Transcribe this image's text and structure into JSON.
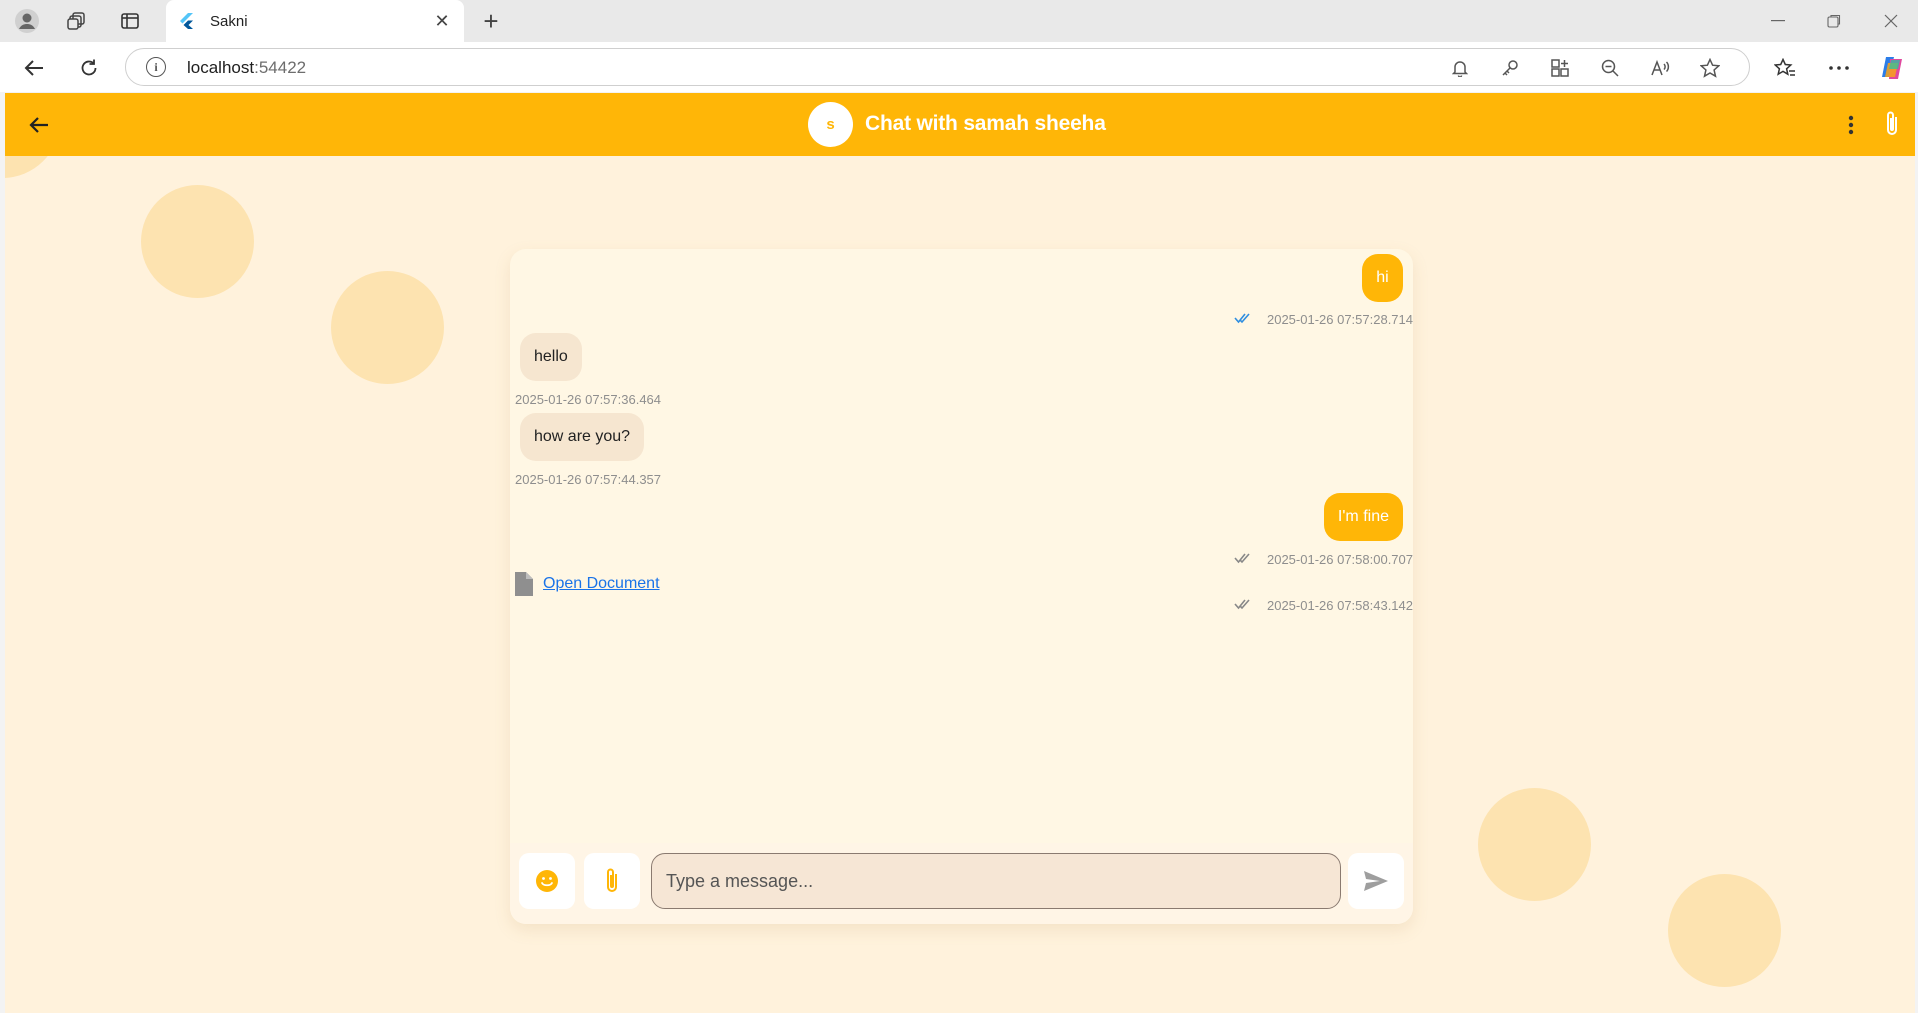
{
  "browser": {
    "tab_title": "Sakni",
    "url_host": "localhost",
    "url_port": ":54422"
  },
  "appbar": {
    "avatar_letter": "s",
    "title": "Chat with samah sheeha",
    "accent_color": "#ffb607"
  },
  "messages": [
    {
      "direction": "out",
      "text": "hi",
      "timestamp": "2025-01-26 07:57:28.714",
      "read": true
    },
    {
      "direction": "in",
      "text": "hello",
      "timestamp": "2025-01-26 07:57:36.464"
    },
    {
      "direction": "in",
      "text": "how are you?",
      "timestamp": "2025-01-26 07:57:44.357"
    },
    {
      "direction": "out",
      "text": "I'm fine",
      "timestamp": "2025-01-26 07:58:00.707",
      "read": false
    },
    {
      "direction": "out",
      "type": "document",
      "text": "Open Document",
      "timestamp": "2025-01-26 07:58:43.142",
      "read": false
    }
  ],
  "composer": {
    "placeholder": "Type a message..."
  },
  "icons": {
    "back": "arrow-left-icon",
    "menu": "more-vertical-icon",
    "attach": "paperclip-icon",
    "emoji": "emoji-icon",
    "send": "send-icon",
    "document": "file-icon"
  }
}
